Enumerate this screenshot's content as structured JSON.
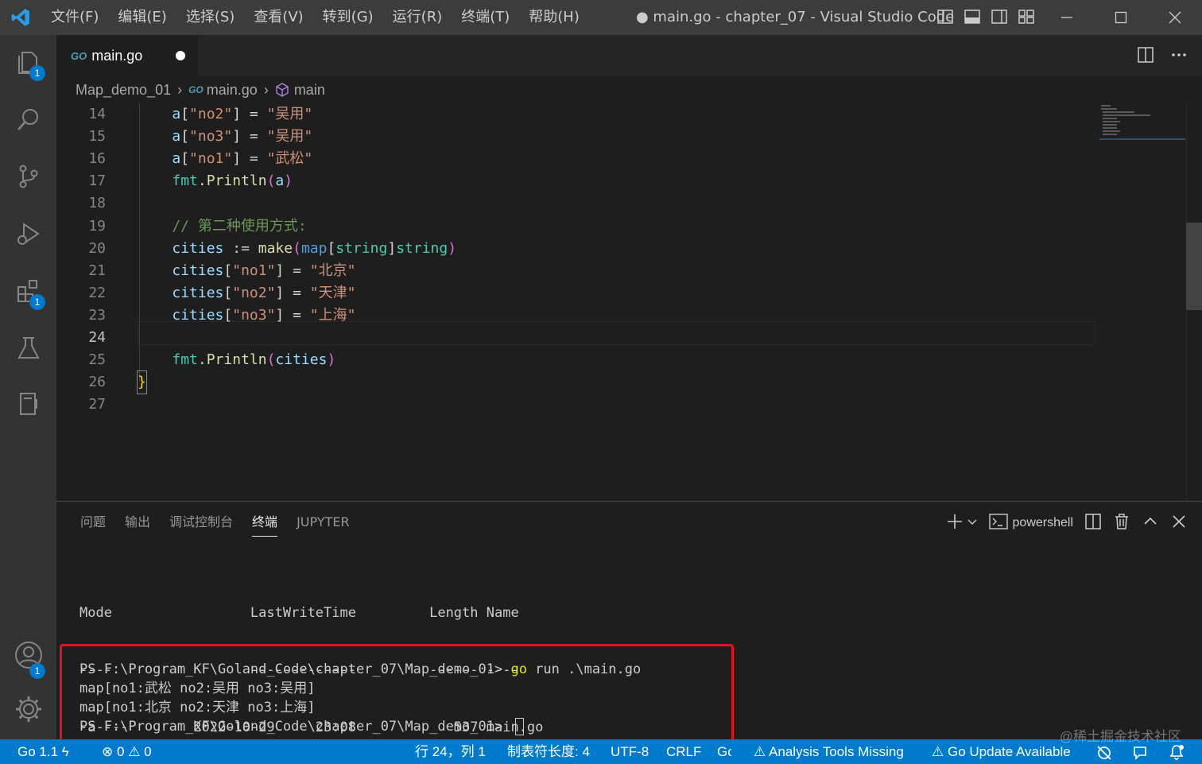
{
  "titlebar": {
    "menu": [
      "文件(F)",
      "编辑(E)",
      "选择(S)",
      "查看(V)",
      "转到(G)",
      "运行(R)",
      "终端(T)",
      "帮助(H)"
    ],
    "title": "● main.go - chapter_07 - Visual Studio Code"
  },
  "activity": {
    "explorer_badge": "1",
    "extensions_badge": "1",
    "accounts_badge": "1"
  },
  "tab": {
    "go_badge": "GO",
    "label": "main.go"
  },
  "breadcrumb": {
    "folder": "Map_demo_01",
    "file": "main.go",
    "symbol": "main",
    "go_badge": "GO"
  },
  "editor": {
    "active_line": "24",
    "lines": [
      {
        "n": "14",
        "html": "    a[\"no2\"] = \"吴用\""
      },
      {
        "n": "15",
        "html": "    a[\"no3\"] = \"吴用\""
      },
      {
        "n": "16",
        "html": "    a[\"no1\"] = \"武松\""
      },
      {
        "n": "17",
        "html": "    fmt.Println(a)"
      },
      {
        "n": "18",
        "html": ""
      },
      {
        "n": "19",
        "html": "    // 第二种使用方式:"
      },
      {
        "n": "20",
        "html": "    cities := make(map[string]string)"
      },
      {
        "n": "21",
        "html": "    cities[\"no1\"] = \"北京\""
      },
      {
        "n": "22",
        "html": "    cities[\"no2\"] = \"天津\""
      },
      {
        "n": "23",
        "html": "    cities[\"no3\"] = \"上海\""
      },
      {
        "n": "24",
        "html": ""
      },
      {
        "n": "25",
        "html": "    fmt.Println(cities)"
      },
      {
        "n": "26",
        "html": "}"
      },
      {
        "n": "27",
        "html": ""
      }
    ]
  },
  "panel": {
    "tabs": [
      "问题",
      "输出",
      "调试控制台",
      "终端",
      "JUPYTER"
    ],
    "active_tab": "终端",
    "terminal_name": "powershell",
    "listing": [
      "Mode                 LastWriteTime         Length Name",
      "----                 -------------         ------ ----",
      "-a----        2022-10-29     23:08            537 main.go"
    ],
    "prompt1": "PS F:\\Program_KF\\Goland_Code\\chapter_07\\Map_demo_01> ",
    "cmd_go": "go",
    "cmd_rest": " run .\\main.go",
    "out1": "map[no1:武松 no2:吴用 no3:吴用]",
    "out2": "map[no1:北京 no2:天津 no3:上海]",
    "prompt2": "PS F:\\Program_KF\\Goland_Code\\chapter_07\\Map_demo_01> "
  },
  "statusbar": {
    "go_version": "Go 1.1",
    "errors": "0",
    "warnings": "0",
    "position": "行 24，列 1",
    "tab_size": "制表符长度: 4",
    "encoding": "UTF-8",
    "eol": "CRLF",
    "lang": "Go",
    "analysis": "Analysis Tools Missing",
    "update": "Go Update Available"
  },
  "watermark": "@稀土掘金技术社区",
  "colors": {
    "statusbar": "#007acc",
    "keyword": "#569cd6",
    "string": "#ce9178",
    "comment": "#6a9955",
    "function": "#dcdcaa",
    "variable": "#9cdcfe",
    "type": "#4ec9b0",
    "highlight_box": "#e81123"
  }
}
